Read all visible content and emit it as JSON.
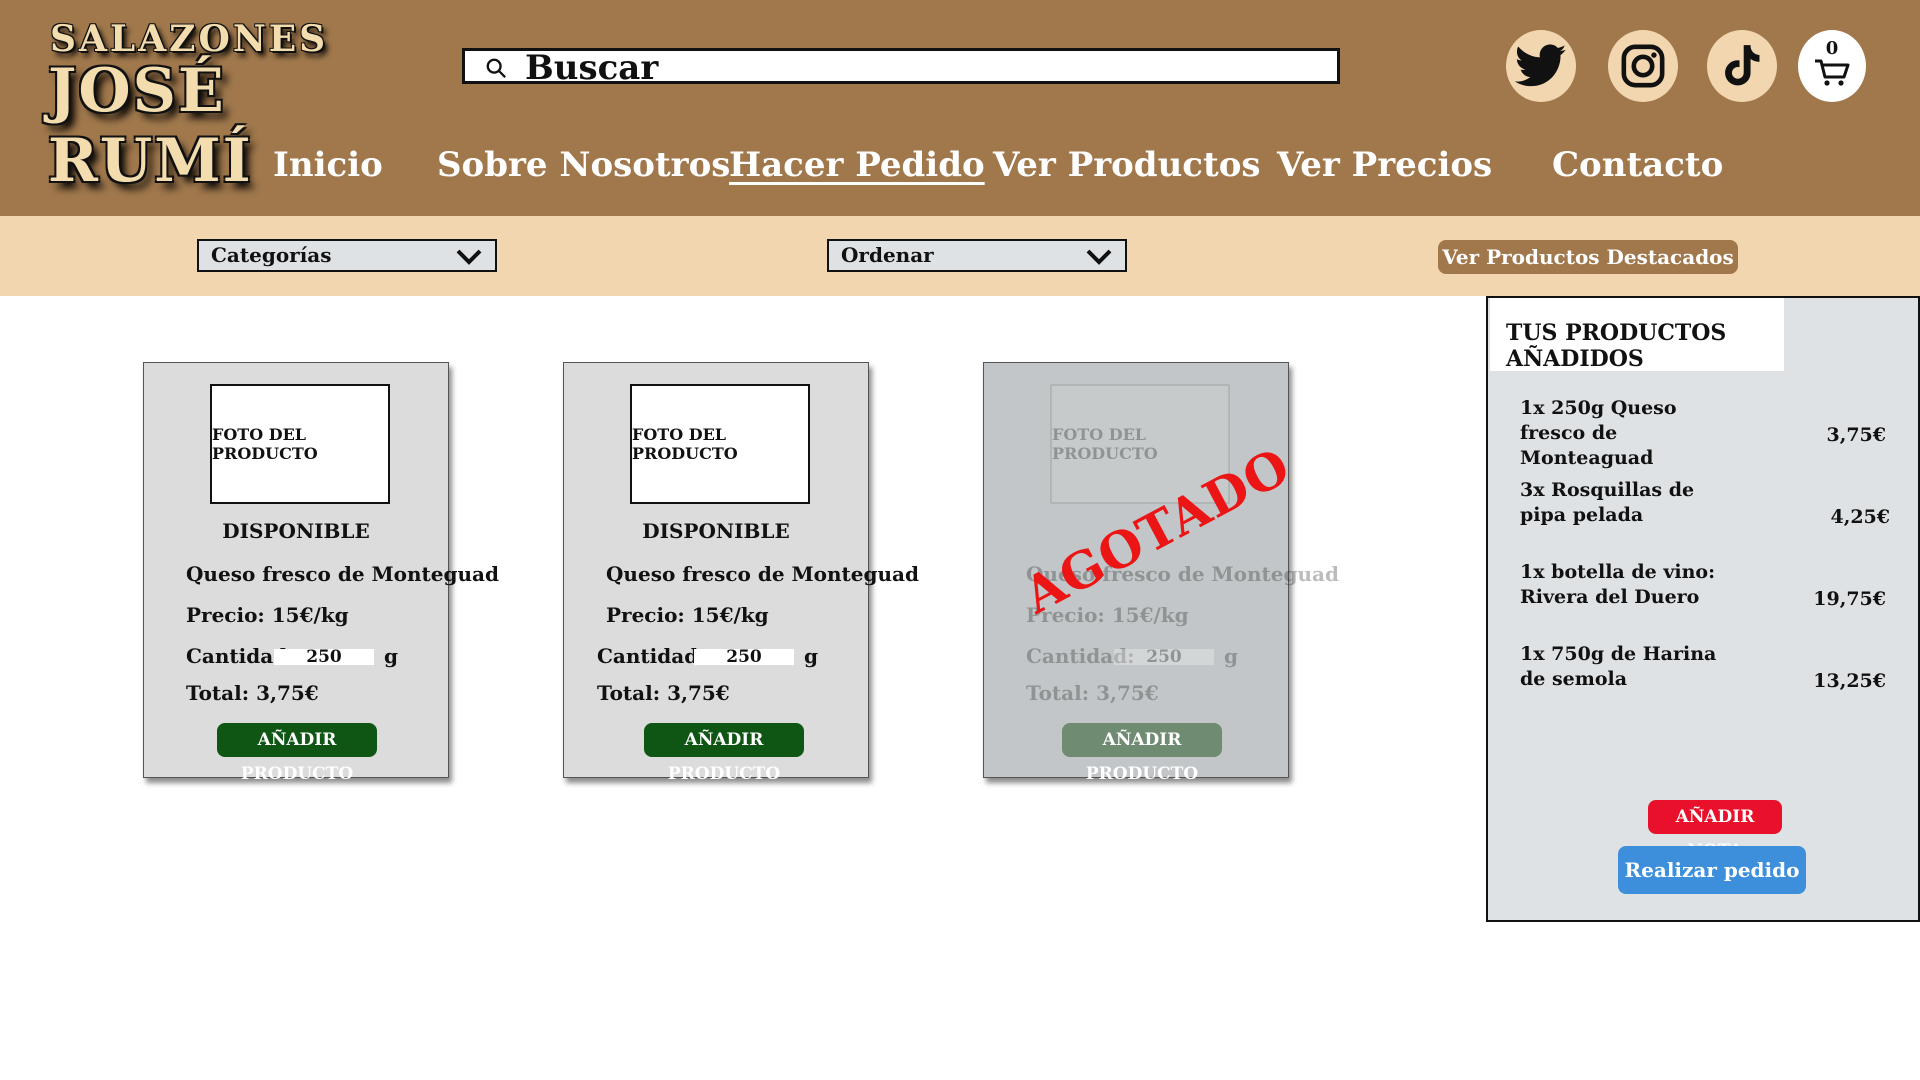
{
  "brand": {
    "line1": "SALAZONES",
    "line2": "JOSÉ RUMÍ"
  },
  "search": {
    "placeholder": "Buscar"
  },
  "social": {
    "icons": [
      "twitter-icon",
      "instagram-icon",
      "tiktok-icon"
    ]
  },
  "cart": {
    "count": "0"
  },
  "nav": {
    "items": [
      {
        "label": "Inicio"
      },
      {
        "label": "Sobre Nosotros"
      },
      {
        "label": "Hacer Pedido",
        "active": true
      },
      {
        "label": "Ver Productos"
      },
      {
        "label": "Ver Precios"
      },
      {
        "label": "Contacto"
      }
    ]
  },
  "filters": {
    "categories_label": "Categorías",
    "sort_label": "Ordenar",
    "featured_button": "Ver Productos Destacados"
  },
  "products": [
    {
      "photo": "FOTO DEL PRODUCTO",
      "status": "DISPONIBLE",
      "name": "Queso fresco de Monteguad",
      "price": "Precio: 15€/kg",
      "qty_label": "Cantidad:",
      "qty": "250",
      "unit": "g",
      "total": "Total: 3,75€",
      "button": "AÑADIR PRODUCTO"
    },
    {
      "photo": "FOTO DEL PRODUCTO",
      "status": "DISPONIBLE",
      "name": "Queso fresco de Monteguad",
      "price": "Precio: 15€/kg",
      "qty_label": "Cantidad:",
      "qty": "250",
      "unit": "g",
      "total": "Total: 3,75€",
      "button": "AÑADIR PRODUCTO"
    },
    {
      "photo": "FOTO DEL PRODUCTO",
      "status": "",
      "name": "Queso fresco de Monteguad",
      "price": "Precio: 15€/kg",
      "qty_label": "Cantidad:",
      "qty": "250",
      "unit": "g",
      "total": "Total: 3,75€",
      "button": "AÑADIR PRODUCTO",
      "stamp": "AGOTADO"
    }
  ],
  "order": {
    "title": "TUS PRODUCTOS AÑADIDOS",
    "items": [
      {
        "desc": "1x 250g Queso fresco de Monteaguad",
        "amount": "3,75€"
      },
      {
        "desc": "3x Rosquillas de pipa pelada",
        "amount": "4,25€"
      },
      {
        "desc": "1x botella de vino: Rivera del Duero",
        "amount": "19,75€"
      },
      {
        "desc": "1x 750g de Harina de semola",
        "amount": "13,25€"
      }
    ],
    "note_button": "AÑADIR NOTA",
    "submit_button": "Realizar pedido"
  },
  "colors": {
    "header": "#a0784c",
    "filterbar": "#f2d6b0",
    "add_button": "#0f5514",
    "note_button": "#e8102a",
    "order_button": "#3d8fdc",
    "soldout_stamp": "#ec1515"
  }
}
